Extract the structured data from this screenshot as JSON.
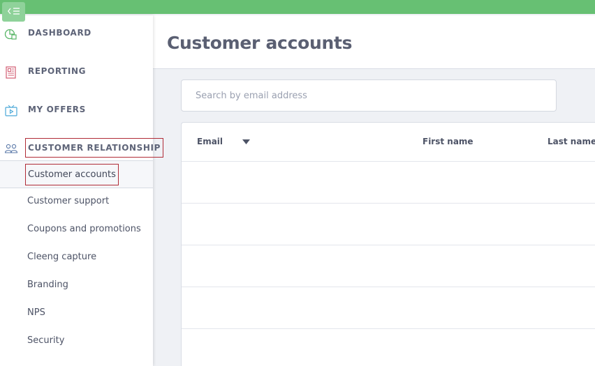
{
  "sidebar": {
    "main": {
      "dashboard": "DASHBOARD",
      "reporting": "REPORTING",
      "my_offers": "MY OFFERS",
      "customer_relationship": "CUSTOMER RELATIONSHIP"
    },
    "sub_items": {
      "customer_accounts": "Customer accounts",
      "customer_support": "Customer support",
      "coupons": "Coupons and promotions",
      "capture": "Cleeng capture",
      "branding": "Branding",
      "nps": "NPS",
      "security": "Security"
    }
  },
  "header": {
    "title": "Customer accounts"
  },
  "search": {
    "placeholder": "Search by email address"
  },
  "table": {
    "columns": {
      "email": "Email",
      "first_name": "First name",
      "last_name": "Last name"
    }
  },
  "colors": {
    "topbar": "#67c073",
    "highlight_border": "#b02b36"
  }
}
